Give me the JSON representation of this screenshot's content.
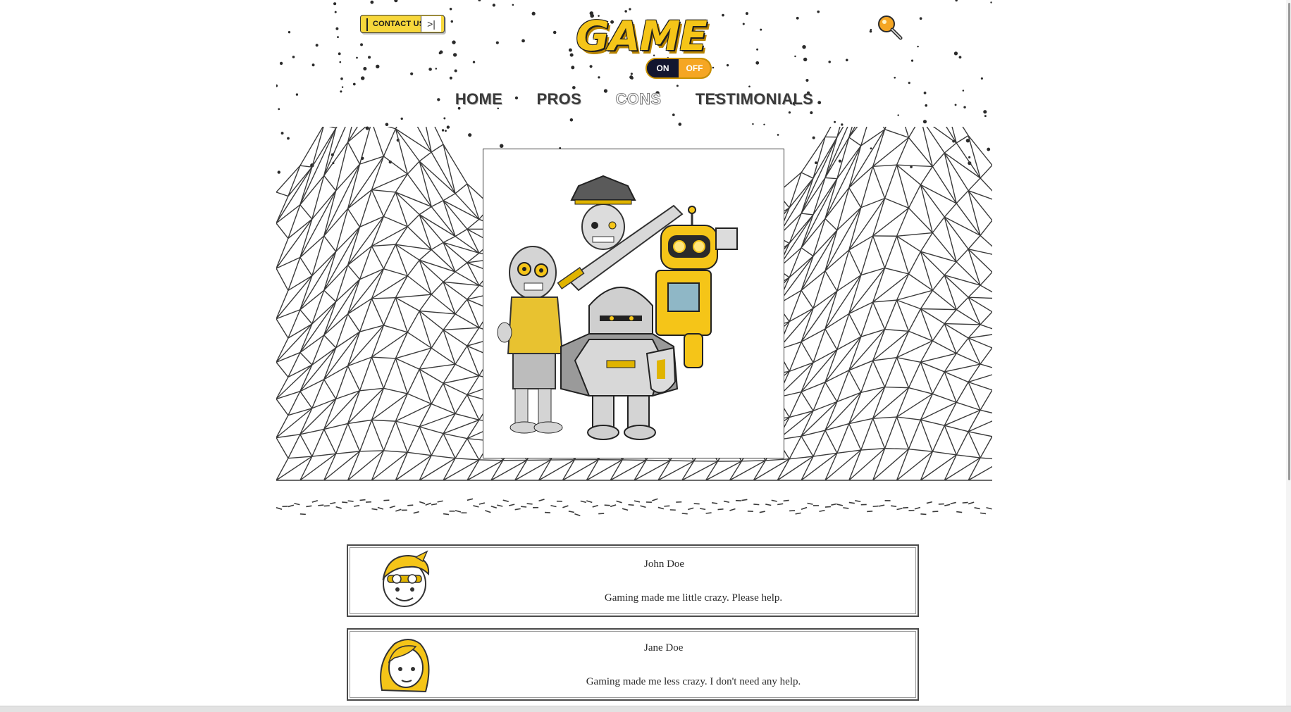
{
  "header": {
    "contact_label": "CONTACT US",
    "contact_arrow": ">|",
    "logo": {
      "word": "GAME",
      "toggle_on": "ON",
      "toggle_off": "OFF"
    }
  },
  "nav": [
    {
      "label": "HOME",
      "active": false
    },
    {
      "label": "PROS",
      "active": false
    },
    {
      "label": "CONS",
      "active": true
    },
    {
      "label": "TESTIMONIALS",
      "active": false
    }
  ],
  "testimonials": [
    {
      "name": "John Doe",
      "quote": "Gaming made me little crazy. Please help.",
      "avatar_icon": "boy-avatar-icon"
    },
    {
      "name": "Jane Doe",
      "quote": "Gaming made me less crazy. I don't need any help.",
      "avatar_icon": "girl-avatar-icon"
    }
  ],
  "colors": {
    "accent": "#f5c518",
    "ink": "#2a2a2a",
    "wire": "#3a3a3a"
  },
  "icons": [
    "search-icon",
    "wireframe-mountains",
    "game-characters-illustration"
  ]
}
